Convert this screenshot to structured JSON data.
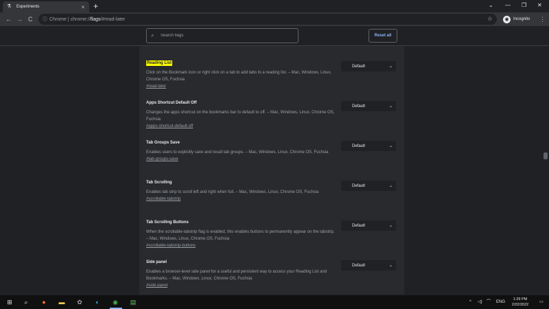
{
  "tab": {
    "title": "Experiments",
    "close": "×"
  },
  "window": {
    "newtab": "+",
    "chevron": "⌄",
    "minimize": "—",
    "maximize": "❐",
    "close": "✕"
  },
  "toolbar": {
    "back": "←",
    "forward": "→",
    "reload": "C",
    "url_prefix": "Chrome | chrome://",
    "url_host": "flags",
    "url_path": "/#read-later",
    "profile_label": "Incognito",
    "menu": "⋮"
  },
  "flags_header": {
    "search_placeholder": "Search flags",
    "reset_label": "Reset all"
  },
  "flags": [
    {
      "name": "Reading List",
      "description": "Click on the Bookmark icon or right click on a tab to add tabs to a reading list. – Mac, Windows, Linux, Chrome OS, Fuchsia",
      "link": "#read-later",
      "value": "Default",
      "highlighted": true
    },
    {
      "name": "Apps Shortcut Default Off",
      "description": "Changes the apps shortcut on the bookmarks bar to default to off. – Mac, Windows, Linux, Chrome OS, Fuchsia",
      "link": "#apps-shortcut-default-off",
      "value": "Default",
      "highlighted": false
    },
    {
      "name": "Tab Groups Save",
      "description": "Enables users to explicitly save and recall tab groups. – Mac, Windows, Linux, Chrome OS, Fuchsia",
      "link": "#tab-groups-save",
      "value": "Default",
      "highlighted": false
    },
    {
      "name": "Tab Scrolling",
      "description": "Enables tab strip to scroll left and right when full. – Mac, Windows, Linux, Chrome OS, Fuchsia",
      "link": "#scrollable-tabstrip",
      "value": "Default",
      "highlighted": false
    },
    {
      "name": "Tab Scrolling Buttons",
      "description": "When the scrollable-tabstrip flag is enabled, this enables buttons to permanently appear on the tabstrip. – Mac, Windows, Linux, Chrome OS, Fuchsia",
      "link": "#scrollable-tabstrip-buttons",
      "value": "Default",
      "highlighted": false
    },
    {
      "name": "Side panel",
      "description": "Enables a browser-level side panel for a useful and persistent way to access your Reading List and Bookmarks. – Mac, Windows, Linux, Chrome OS, Fuchsia",
      "link": "#side-panel",
      "value": "Default",
      "highlighted": false
    }
  ],
  "taskbar": {
    "lang": "ENG",
    "time": "1:29 PM",
    "date": "2/22/2022"
  },
  "colors": {
    "accent": "#8ab4f8",
    "highlight": "#ffff00",
    "background": "#202124",
    "panel": "#292a2d"
  }
}
